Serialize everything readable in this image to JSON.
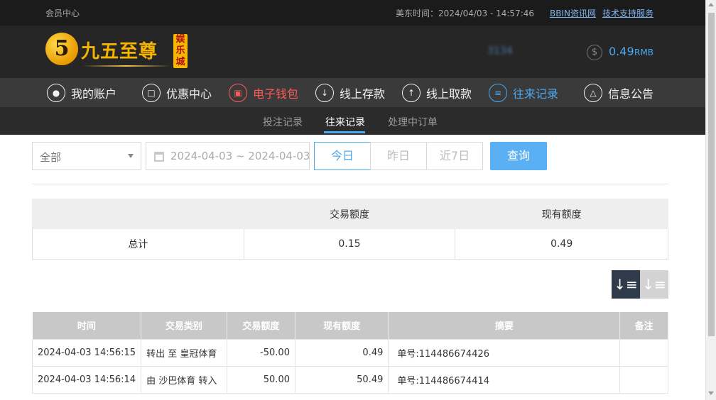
{
  "topbar": {
    "member_center": "会员中心",
    "time_label": "美东时间：2024/04/03 - 14:57:46",
    "link_bbin": "BBIN资讯网",
    "link_support": "技术支持服务"
  },
  "brand": {
    "logo_mark": "5",
    "logo_text": "九五至尊",
    "logo_badge": "娱乐城",
    "user_masked": "3134",
    "balance_value": "0.49",
    "balance_unit": "RMB"
  },
  "nav": {
    "items": [
      {
        "label": "我的账户",
        "icon": "user-icon"
      },
      {
        "label": "优惠中心",
        "icon": "gift-icon"
      },
      {
        "label": "电子钱包",
        "icon": "wallet-icon"
      },
      {
        "label": "线上存款",
        "icon": "deposit-icon"
      },
      {
        "label": "线上取款",
        "icon": "withdraw-icon"
      },
      {
        "label": "往来记录",
        "icon": "records-icon"
      },
      {
        "label": "信息公告",
        "icon": "bell-icon"
      }
    ]
  },
  "subnav": {
    "tabs": [
      {
        "label": "投注记录"
      },
      {
        "label": "往来记录"
      },
      {
        "label": "处理中订单"
      }
    ]
  },
  "filters": {
    "type_value": "全部",
    "date_range": "2024-04-03 ~ 2024-04-03",
    "btn_today": "今日",
    "btn_yesterday": "昨日",
    "btn_7days": "近7日",
    "btn_query": "查询"
  },
  "summary": {
    "col_amount": "交易额度",
    "col_balance": "现有额度",
    "row_label": "总计",
    "amount": "0.15",
    "balance": "0.49"
  },
  "records": {
    "headers": [
      "时间",
      "交易类别",
      "交易额度",
      "现有额度",
      "摘要",
      "备注"
    ],
    "rows": [
      [
        "2024-04-03 14:56:15",
        "转出 至 皇冠体育",
        "-50.00",
        "0.49",
        "单号:114486674426",
        ""
      ],
      [
        "2024-04-03 14:56:14",
        "由 沙巴体育 转入",
        "50.00",
        "50.49",
        "单号:114486674414",
        ""
      ]
    ]
  },
  "colors": {
    "accent_blue": "#4aa8f0",
    "wallet_red": "#ff5a5a",
    "logo_gold": "#f5b400"
  }
}
